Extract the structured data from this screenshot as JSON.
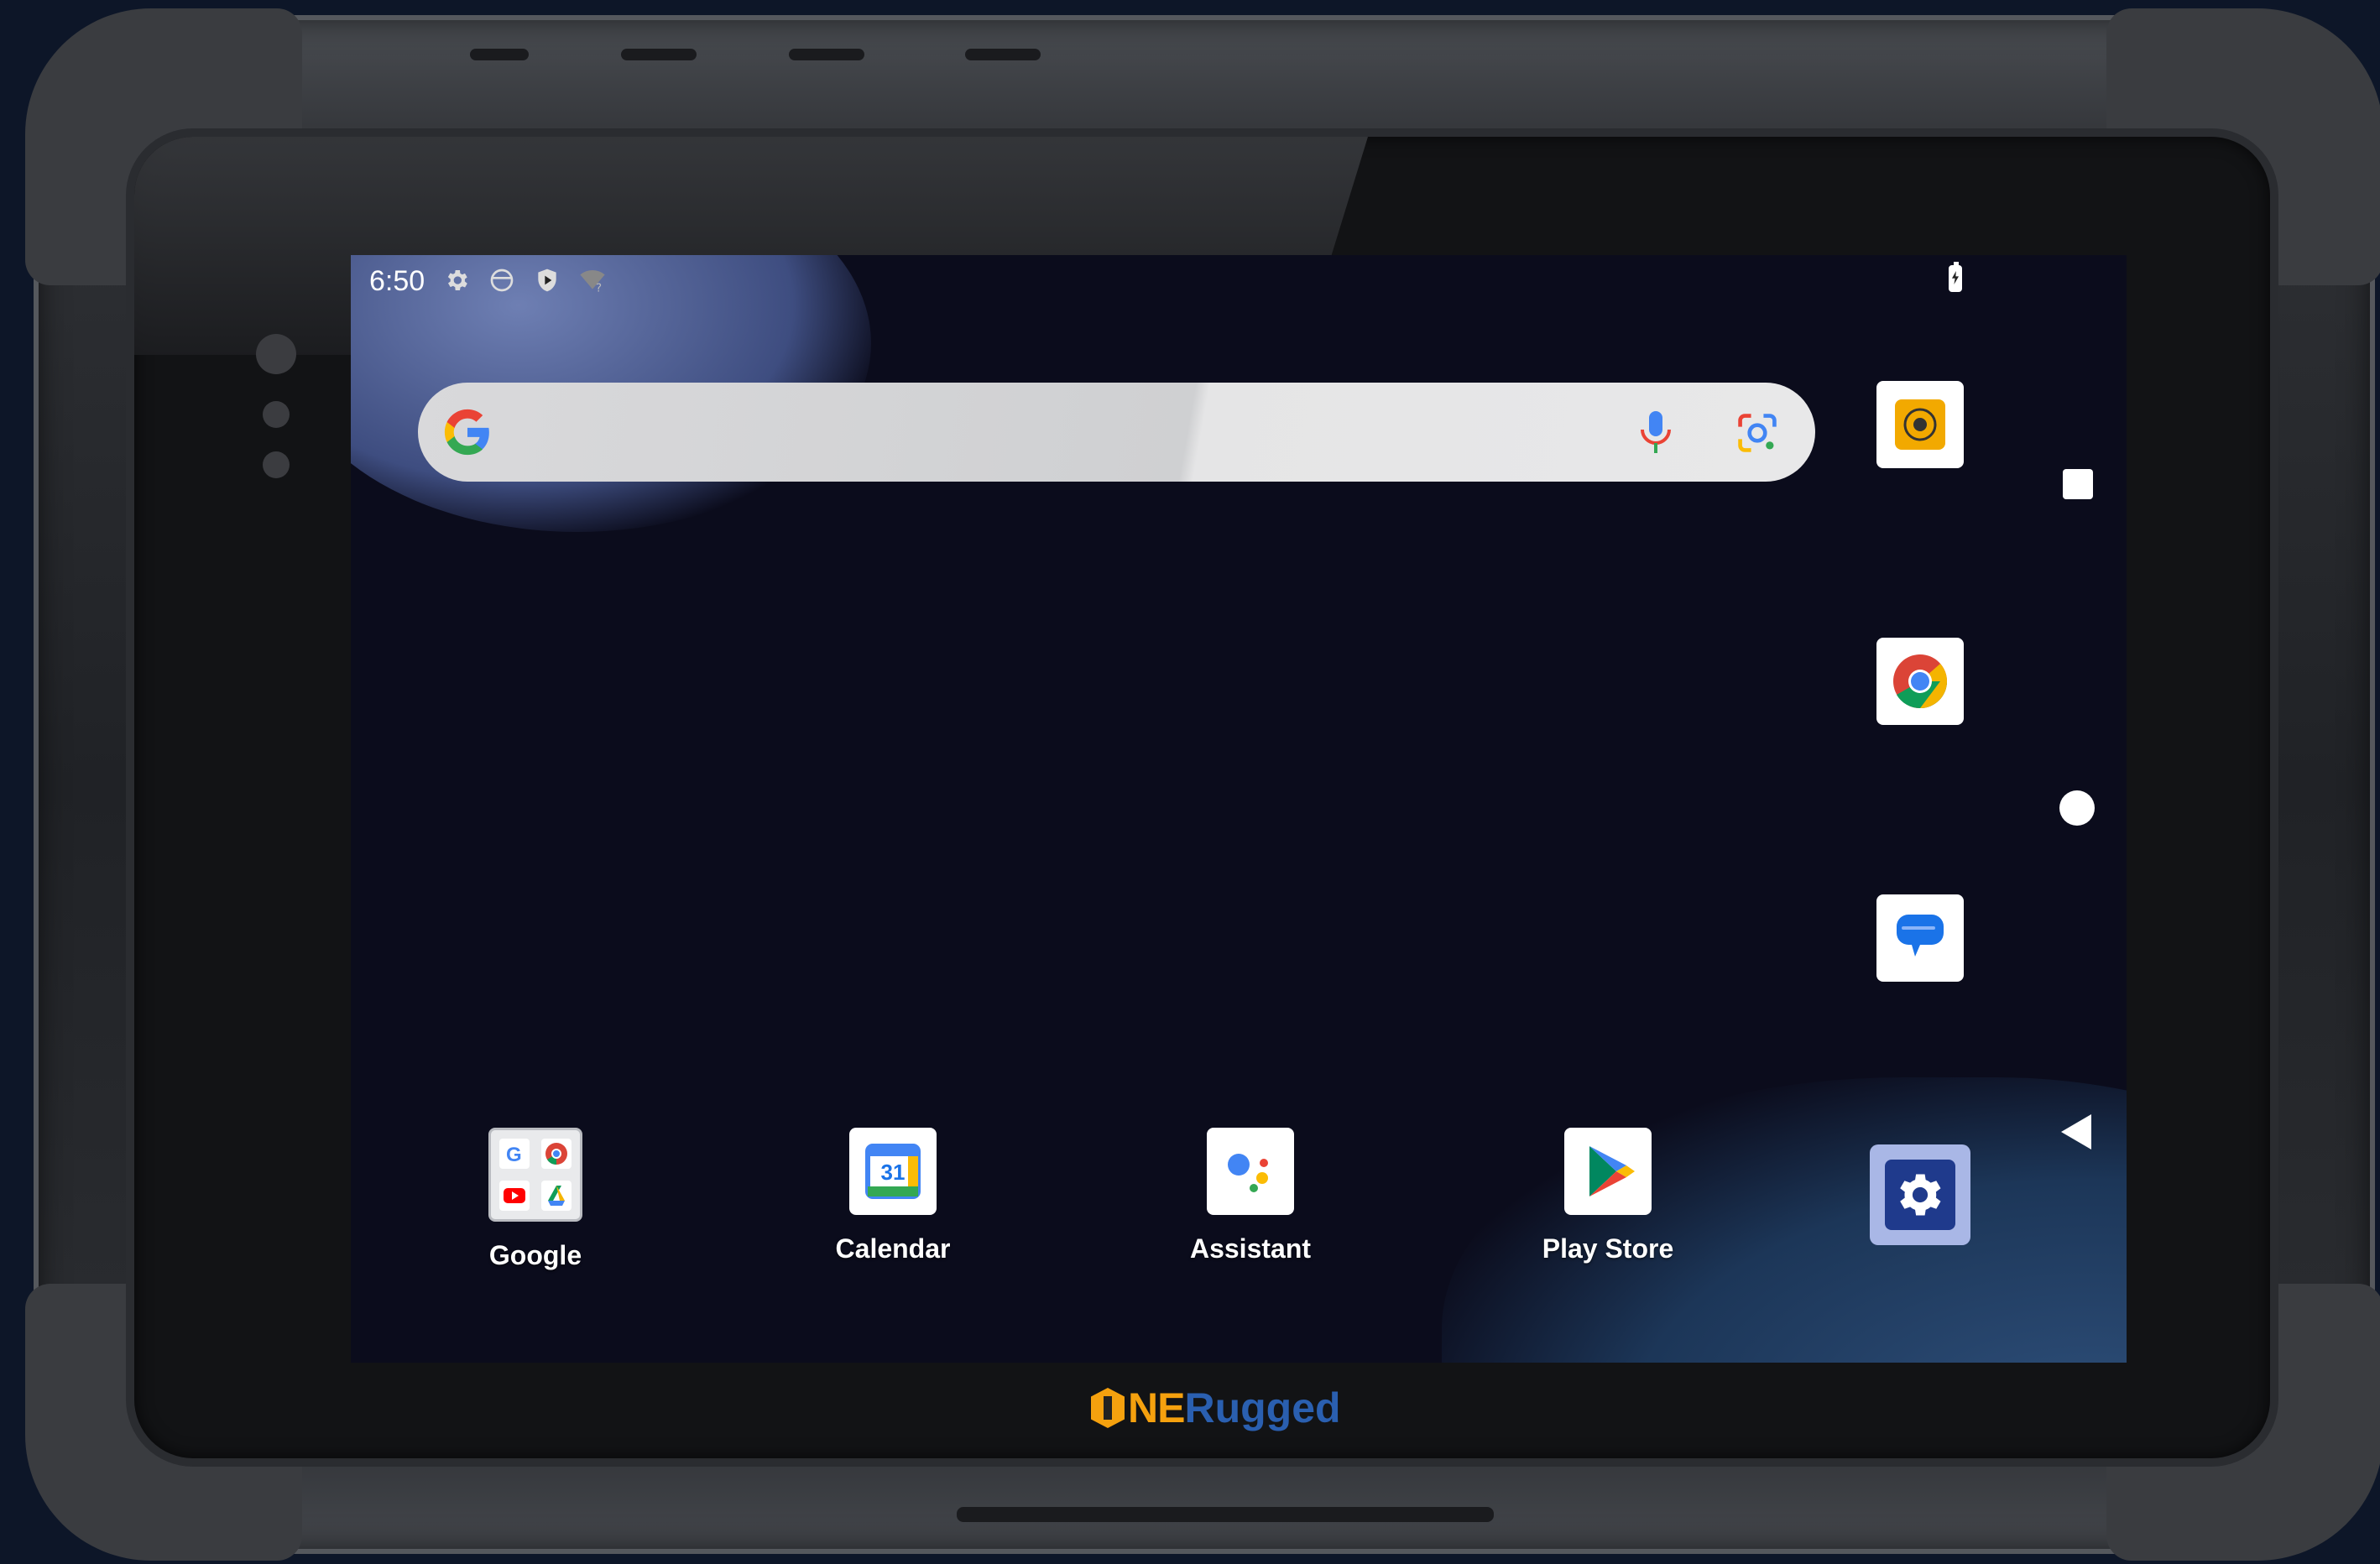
{
  "status_bar": {
    "time": "6:50",
    "icons": [
      "settings-icon",
      "vpn-globe-icon",
      "shield-play-icon",
      "wifi-unknown-icon"
    ],
    "battery": "battery-charging-icon"
  },
  "search": {
    "logo": "google-g-icon",
    "voice": "mic-icon",
    "lens": "google-lens-icon"
  },
  "side_apps": [
    {
      "name": "camera-app",
      "icon": "camera-shutter-icon",
      "color": "#f2a900"
    },
    {
      "name": "chrome",
      "icon": "chrome-icon"
    },
    {
      "name": "messages",
      "icon": "messages-icon",
      "color": "#1a73e8"
    }
  ],
  "navigation": {
    "recents": "square-icon",
    "home": "circle-icon",
    "back": "triangle-back-icon"
  },
  "dock": [
    {
      "label": "Google",
      "icon": "google-folder-icon"
    },
    {
      "label": "Calendar",
      "icon": "calendar-icon",
      "day": "31"
    },
    {
      "label": "Assistant",
      "icon": "assistant-icon"
    },
    {
      "label": "Play Store",
      "icon": "play-store-icon"
    }
  ],
  "settings_app": {
    "icon": "settings-gear-icon"
  },
  "brand": {
    "part1": "NE",
    "part2": "Rugged",
    "accent": "#f5a10e",
    "secondary": "#2a5fb0"
  }
}
